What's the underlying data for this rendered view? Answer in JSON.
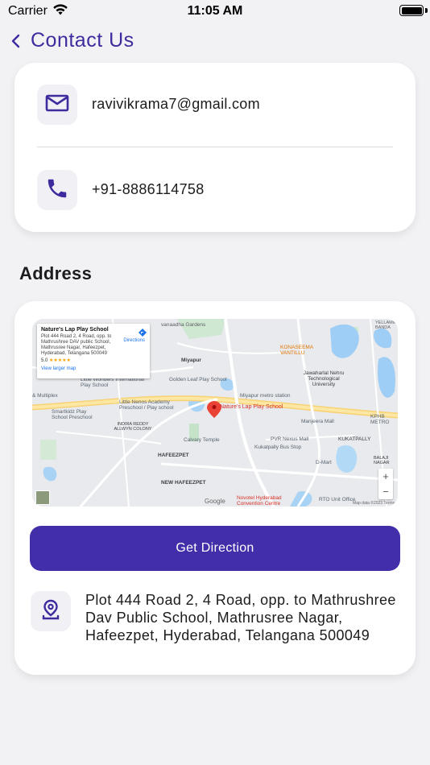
{
  "status_bar": {
    "carrier": "Carrier",
    "time": "11:05 AM"
  },
  "nav": {
    "title": "Contact Us"
  },
  "contact": {
    "email": "ravivikrama7@gmail.com",
    "phone": "+91-8886114758"
  },
  "address_section": {
    "title": "Address",
    "button_label": "Get Direction",
    "address": "Plot 444 Road 2, 4 Road, opp. to Mathrushree Dav Public School, Mathrusree Nagar, Hafeezpet, Hyderabad, Telangana 500049"
  },
  "map": {
    "popup_title": "Nature's Lap Play School",
    "popup_address": "Plot 444 Road 2, 4 Road, opp. to Mathrushree DAV public School, Mathrusree Nagar, Hafeezpet, Hyderabad, Telangana 500049",
    "popup_rating": "5.0",
    "popup_stars": "★★★★★",
    "popup_link": "View larger map",
    "popup_directions": "Directions",
    "pin_label": "Nature's Lap Play School",
    "zoom_in": "+",
    "zoom_out": "−",
    "google": "Google",
    "labels": {
      "vanaadha": "vanaadha Gardens",
      "yellamma": "YELLAMMA BANDA",
      "konaseema": "KONASEEMA VANTILLU",
      "miyapur": "Miyapur",
      "golden_leaf": "Golden Leaf Play School",
      "jntu": "Jawaharlal Nehru Technological University",
      "little_wonders": "Little Wonders International Play School",
      "multiplex": "& Multiplex",
      "metro": "Miyapur metro station",
      "little_nenos": "Little Nenos Academy Preschool / Play school",
      "smartkidz": "Smartkidz Play School Preschool",
      "manjeera": "Manjeera Mall",
      "kphb": "KPHB METRO",
      "indira": "INDIRA REDDY ALLWYN COLONY",
      "calvary": "Calvary Temple",
      "pvr": "PVR Nexus Mall",
      "kukatpally": "KUKATPALLY",
      "kukatpally_bus": "Kukatpally Bus Stop",
      "hafeezpet": "HAFEEZPET",
      "dmart": "D-Mart",
      "balaji": "BALAJI NAGAR",
      "new_hafeezpet": "NEW HAFEEZPET",
      "novotel": "Novotel Hyderabad Convention Centre",
      "rto": "RTO Unit Office",
      "attrib": "Map data ©2023 Terms"
    }
  },
  "colors": {
    "accent": "#432eaa",
    "title": "#3f2a9e"
  }
}
